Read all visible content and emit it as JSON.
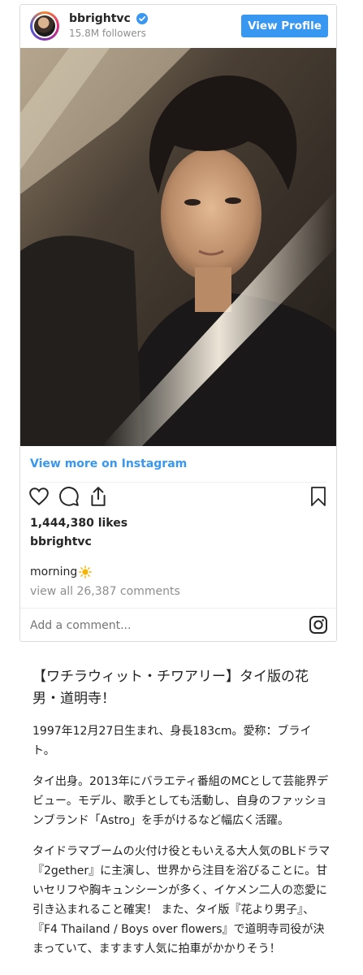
{
  "post": {
    "username": "bbrightvc",
    "followers": "15.8M followers",
    "view_profile": "View Profile",
    "view_more": "View more on Instagram",
    "likes": "1,444,380 likes",
    "caption_user": "bbrightvc",
    "caption": "morning",
    "caption_emoji": "sun-emoji",
    "comments": "view all 26,387 comments",
    "comment_placeholder": "Add a comment...",
    "colors": {
      "accent": "#3897f0",
      "verified": "#3897f0",
      "muted": "#8e8e8e"
    },
    "icons": [
      "heart-icon",
      "comment-icon",
      "share-icon",
      "bookmark-icon",
      "instagram-icon",
      "verified-badge-icon"
    ]
  },
  "article": {
    "title": "【ワチラウィット・チワアリー】タイ版の花男・道明寺！",
    "p1": "1997年12月27日生まれ、身長183cm。愛称：ブライト。",
    "p2": "タイ出身。2013年にバラエティ番組のMCとして芸能界デビュー。モデル、歌手としても活動し、自身のファッションブランド「Astro」を手がけるなど幅広く活躍。",
    "p3": "タイドラマブームの火付け役ともいえる大人気のBLドラマ『2gether』に主演し、世界から注目を浴びることに。甘いセリフや胸キュンシーンが多く、イケメン二人の恋愛に引き込まれること確実！ また、タイ版『花より男子』、『F4 Thailand / Boys over flowers』で道明寺司役が決まっていて、ますます人気に拍車がかかりそう！"
  }
}
